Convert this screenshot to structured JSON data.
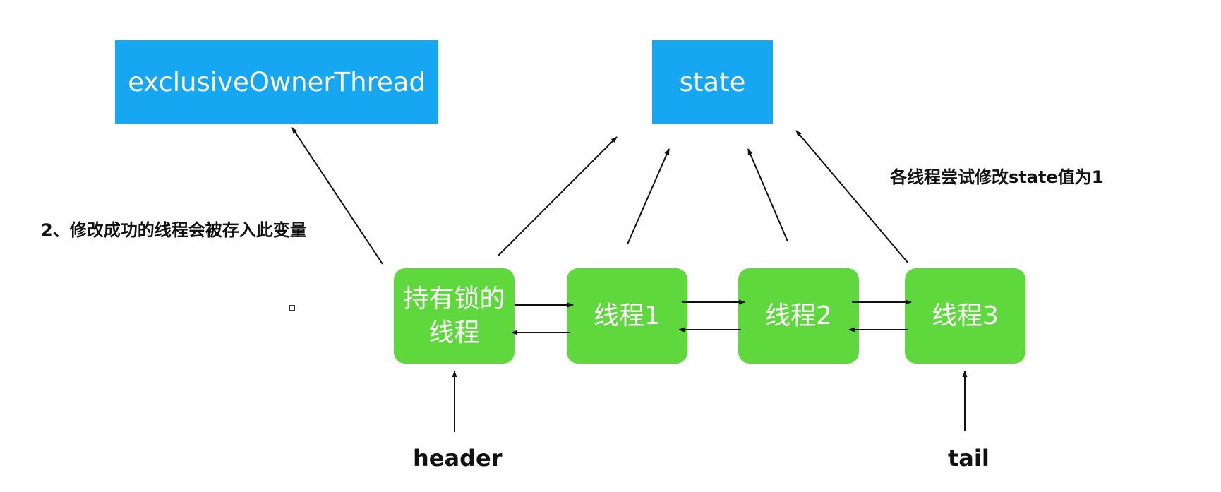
{
  "boxes": {
    "owner": "exclusiveOwnerThread",
    "state": "state",
    "holder_line1": "持有锁的",
    "holder_line2": "线程",
    "thread1": "线程1",
    "thread2": "线程2",
    "thread3": "线程3"
  },
  "labels": {
    "owner_note": "2、修改成功的线程会被存入此变量",
    "state_note": "各线程尝试修改state值为1",
    "header": "header",
    "tail": "tail"
  },
  "colors": {
    "blue_box": "#17a7f2",
    "green_box": "#5fd83d",
    "arrow": "#111111"
  }
}
